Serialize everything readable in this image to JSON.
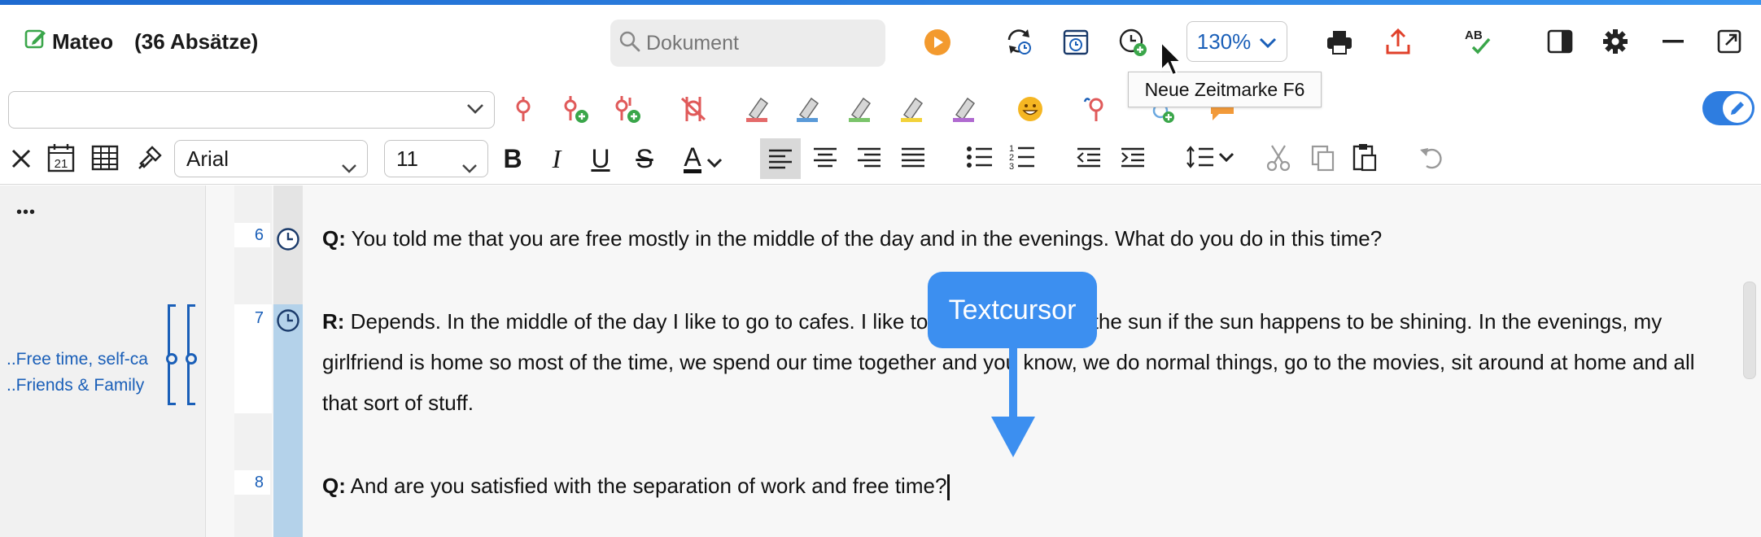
{
  "header": {
    "doc_name": "Mateo",
    "paragraph_count": "(36 Absätze)",
    "search_placeholder": "Dokument",
    "zoom": "130%",
    "tooltip": "Neue Zeitmarke  F6"
  },
  "format_toolbar": {
    "font_name": "Arial",
    "font_size": "11",
    "bold": "B",
    "italic": "I",
    "underline": "U",
    "strike": "S",
    "font_color": "A"
  },
  "left_panel": {
    "menu": "•••",
    "codes": [
      "..Free time, self-ca",
      "..Friends & Family"
    ]
  },
  "document": {
    "paragraphs": [
      {
        "number": "6",
        "speaker": "Q:",
        "text": " You told me that you are free mostly in the middle of the day and in the evenings. What do you do in this time?"
      },
      {
        "number": "7",
        "speaker": "R:",
        "text": " Depends. In the middle of the day I like to go to cafes. I like to sit outside out in the sun if the sun happens to be shining. In the evenings, my girlfriend is home so most of the time, we spend our time together and you know, we do normal things, go to the movies, sit around at home and all that sort of stuff."
      },
      {
        "number": "8",
        "speaker": "Q:",
        "text": " And are you satisfied with the separation of work and free time?"
      }
    ]
  },
  "annotation": {
    "callout": "Textcursor"
  },
  "colors": {
    "accent": "#2e7de0",
    "callout": "#3c8ff0",
    "link_blue": "#1a5fb8",
    "play_orange": "#f39a2e",
    "time_selection": "#b4d2ea"
  }
}
